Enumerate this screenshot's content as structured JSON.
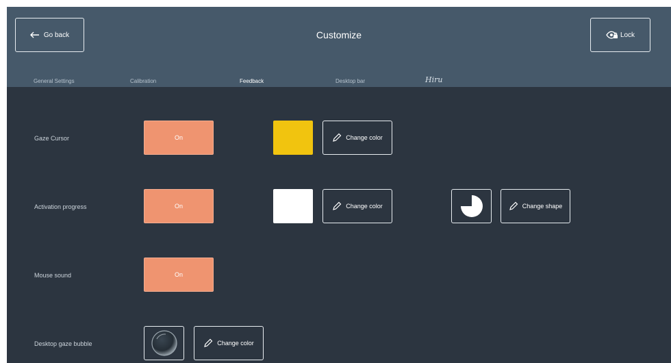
{
  "header": {
    "title": "Customize",
    "go_back_label": "Go back",
    "lock_label": "Lock"
  },
  "tabs": [
    {
      "label": "General Settings",
      "active": false
    },
    {
      "label": "Calibration",
      "active": false
    },
    {
      "label": "Feedback",
      "active": true
    },
    {
      "label": "Desktop bar",
      "active": false
    },
    {
      "label": "Hiru",
      "active": false
    }
  ],
  "rows": {
    "gaze_cursor": {
      "label": "Gaze Cursor",
      "toggle": "On",
      "color": "#f1c40f",
      "change_color_label": "Change color"
    },
    "activation_progress": {
      "label": "Activation progress",
      "toggle": "On",
      "color": "#ffffff",
      "change_color_label": "Change color",
      "change_shape_label": "Change shape",
      "shape_icon": "pie-progress-icon"
    },
    "mouse_sound": {
      "label": "Mouse sound",
      "toggle": "On"
    },
    "desktop_gaze_bubble": {
      "label": "Desktop gaze bubble",
      "change_color_label": "Change color",
      "bubble_icon": "gaze-bubble-icon"
    }
  },
  "colors": {
    "background": "#2c3540",
    "header": "#46596a",
    "toggle_on": "#ef9470"
  }
}
